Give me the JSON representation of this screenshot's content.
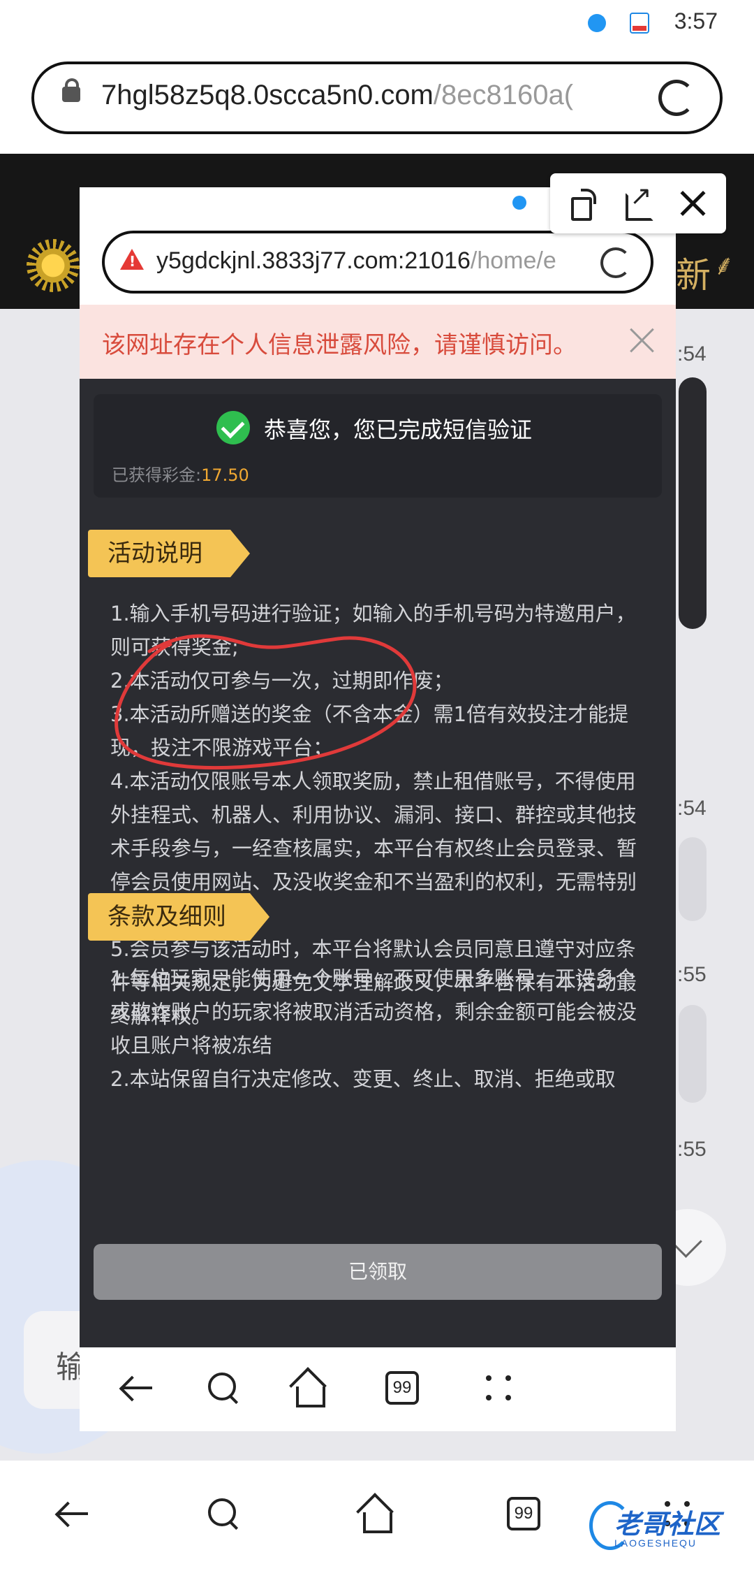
{
  "status_bar": {
    "time": "3:57"
  },
  "outer_browser": {
    "url_host": "7hgl58z5q8.0scca5n0.com",
    "url_path": "/8ec8160a("
  },
  "background_page": {
    "times": [
      ":54",
      ":54",
      ":55",
      ":55"
    ],
    "input_placeholder": "输"
  },
  "popup": {
    "url_host": "y5gdckjnl.3833j77.com:21016",
    "url_path": "/home/e",
    "warning_banner": "该网址存在个人信息泄露风险，请谨慎访问。",
    "success_title": "恭喜您，您已完成短信验证",
    "bonus_label": "已获得彩金:",
    "bonus_amount": "17.50",
    "section1_title": "活动说明",
    "rules1": [
      "1.输入手机号码进行验证；如输入的手机号码为特邀用户，则可获得奖金;",
      "2.本活动仅可参与一次，过期即作废；",
      "3.本活动所赠送的奖金（不含本金）需1倍有效投注才能提现，投注不限游戏平台；",
      "4.本活动仅限账号本人领取奖励，禁止租借账号，不得使用外挂程式、机器人、利用协议、漏洞、接口、群控或其他技术手段参与，一经查核属实，本平台有权终止会员登录、暂停会员使用网站、及没收奖金和不当盈利的权利，无需特别通知；",
      "5.会员参与该活动时，本平台将默认会员同意且遵守对应条件等相关规定，为避免文字理解歧义，本平台保有本活动最终解释权。"
    ],
    "section2_title": "条款及细则",
    "rules2": [
      "1.每位玩家只能使用一个账号，不可使用多账号，开设多个或欺诈账户的玩家将被取消活动资格，剩余金额可能会被没收且账户将被冻结",
      "2.本站保留自行决定修改、变更、终止、取消、拒绝或取"
    ],
    "claim_button": "已领取",
    "tab_count": "99"
  },
  "outer_nav": {
    "tab_count": "99"
  },
  "watermark": {
    "text": "老哥社区",
    "sub": "LAOGESHEQU"
  },
  "colors": {
    "accent_tag": "#f4c455",
    "bonus_amount": "#f0a832",
    "warning_text": "#d84b3c",
    "success_green": "#2fbe4f",
    "annotation_red": "#e03a3a"
  },
  "icons": {
    "outer_url": [
      "lock-icon",
      "reload-icon"
    ],
    "popup_url": [
      "warning-triangle-icon",
      "reload-icon"
    ],
    "toolbar": [
      "rotate-icon",
      "open-external-icon",
      "close-icon"
    ],
    "nav": [
      "back-icon",
      "search-icon",
      "home-icon",
      "tabs-icon",
      "more-icon"
    ]
  }
}
